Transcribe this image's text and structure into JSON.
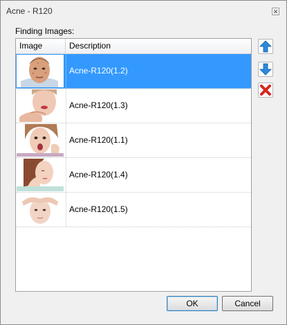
{
  "window": {
    "title": "Acne - R120",
    "close_glyph": "✕"
  },
  "section_label": "Finding Images:",
  "list": {
    "columns": [
      "Image",
      "Description"
    ],
    "rows": [
      {
        "description": "Acne-R120(1.2)",
        "selected": true,
        "image": "man-face-acne"
      },
      {
        "description": "Acne-R120(1.3)",
        "selected": false,
        "image": "woman-touching-chin"
      },
      {
        "description": "Acne-R120(1.1)",
        "selected": false,
        "image": "woman-surprised-face"
      },
      {
        "description": "Acne-R120(1.4)",
        "selected": false,
        "image": "illustrated-woman-hand-face"
      },
      {
        "description": "Acne-R120(1.5)",
        "selected": false,
        "image": "woman-hands-forehead"
      }
    ]
  },
  "side_buttons": [
    {
      "name": "move-up-button",
      "icon": "arrow-up-icon",
      "color": "#1e7fd6"
    },
    {
      "name": "move-down-button",
      "icon": "arrow-down-icon",
      "color": "#1e7fd6"
    },
    {
      "name": "delete-button",
      "icon": "red-x-icon",
      "color": "#d8261e"
    }
  ],
  "buttons": {
    "ok_label": "OK",
    "cancel_label": "Cancel"
  },
  "colors": {
    "selection": "#3399ff",
    "window_bg": "#f0f0f0"
  }
}
